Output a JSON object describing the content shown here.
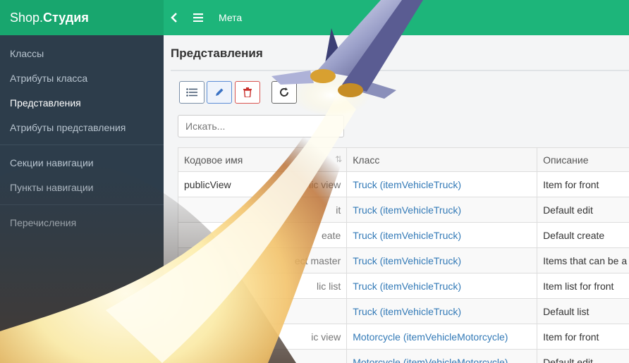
{
  "header": {
    "brand_light": "Shop.",
    "brand_bold": "Студия",
    "back_icon": "chevron-left-icon",
    "menu_icon": "hamburger-icon",
    "title": "Мета"
  },
  "sidebar": {
    "items": [
      {
        "label": "Классы"
      },
      {
        "label": "Атрибуты класса"
      },
      {
        "label": "Представления"
      },
      {
        "label": "Атрибуты представления"
      },
      {
        "label": "Секции навигации"
      },
      {
        "label": "Пункты навигации"
      },
      {
        "label": "Перечисления"
      }
    ]
  },
  "main": {
    "title": "Представления",
    "toolbar": {
      "list_icon": "list-icon",
      "edit_icon": "pencil-icon",
      "delete_icon": "trash-icon",
      "refresh_icon": "refresh-icon"
    },
    "search_placeholder": "Искать...",
    "table": {
      "columns": [
        "Кодовое имя",
        "Класс",
        "Описание"
      ],
      "rows": [
        {
          "code": "publicView",
          "code_tail": "lic view",
          "class": "Truck (itemVehicleTruck)",
          "desc": "Item for front"
        },
        {
          "code": "",
          "code_tail": "it",
          "class": "Truck (itemVehicleTruck)",
          "desc": "Default edit"
        },
        {
          "code": "",
          "code_tail": "eate",
          "class": "Truck (itemVehicleTruck)",
          "desc": "Default create"
        },
        {
          "code": "",
          "code_tail": "ect master",
          "class": "Truck (itemVehicleTruck)",
          "desc": "Items that can be a"
        },
        {
          "code": "",
          "code_tail": "lic list",
          "class": "Truck (itemVehicleTruck)",
          "desc": "Item list for front"
        },
        {
          "code": "",
          "code_tail": "",
          "class": "Truck (itemVehicleTruck)",
          "desc": "Default list"
        },
        {
          "code": "",
          "code_tail": "ic view",
          "class": "Motorcycle (itemVehicleMotorcycle)",
          "desc": "Item for front"
        },
        {
          "code": "",
          "code_tail": "",
          "class": "Motorcycle (itemVehicleMotorcycle)",
          "desc": "Default edit"
        }
      ]
    }
  },
  "colors": {
    "brand_green": "#18a66e",
    "nav_green": "#1db57a",
    "sidebar_bg": "#2d3d4b",
    "link_blue": "#337ab7"
  }
}
